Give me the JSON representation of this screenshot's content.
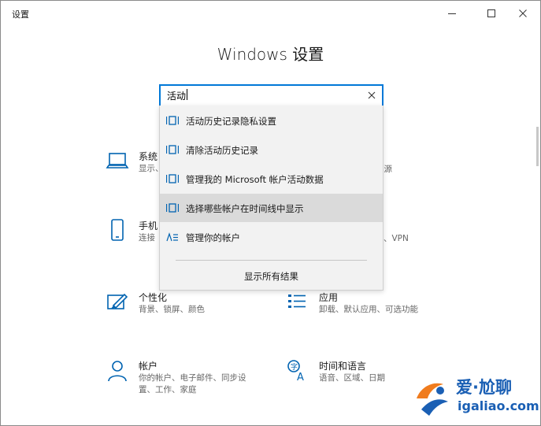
{
  "window": {
    "title": "设置"
  },
  "page_title": "Windows 设置",
  "search": {
    "value": "活动"
  },
  "dropdown": {
    "suggestions": [
      {
        "label": "活动历史记录隐私设置",
        "icon": "timeline-icon"
      },
      {
        "label": "清除活动历史记录",
        "icon": "timeline-icon"
      },
      {
        "label": "管理我的 Microsoft 帐户活动数据",
        "icon": "timeline-icon"
      },
      {
        "label": "选择哪些帐户在时间线中显示",
        "icon": "timeline-icon",
        "highlighted": true
      },
      {
        "label": "管理你的帐户",
        "icon": "person-list-icon"
      }
    ],
    "show_all": "显示所有结果"
  },
  "categories": {
    "system": {
      "title": "系统",
      "desc1": "显示、",
      "peek": "知、电源"
    },
    "phone": {
      "title": "手机",
      "desc1": "连接",
      "peek": "、VPN"
    },
    "personal": {
      "title": "个性化",
      "desc1": "背景、锁屏、颜色"
    },
    "apps": {
      "title": "应用",
      "desc1": "卸载、默认应用、可选功能"
    },
    "accounts": {
      "title": "帐户",
      "desc1": "你的帐户、电子邮件、同步设",
      "desc2": "置、工作、家庭"
    },
    "time": {
      "title": "时间和语言",
      "desc1": "语音、区域、日期"
    }
  },
  "watermark": {
    "line1": "爱·尬聊",
    "line2": "igaliao.com"
  },
  "colors": {
    "accent": "#0078d7",
    "watermark": "#1a5fb4"
  }
}
